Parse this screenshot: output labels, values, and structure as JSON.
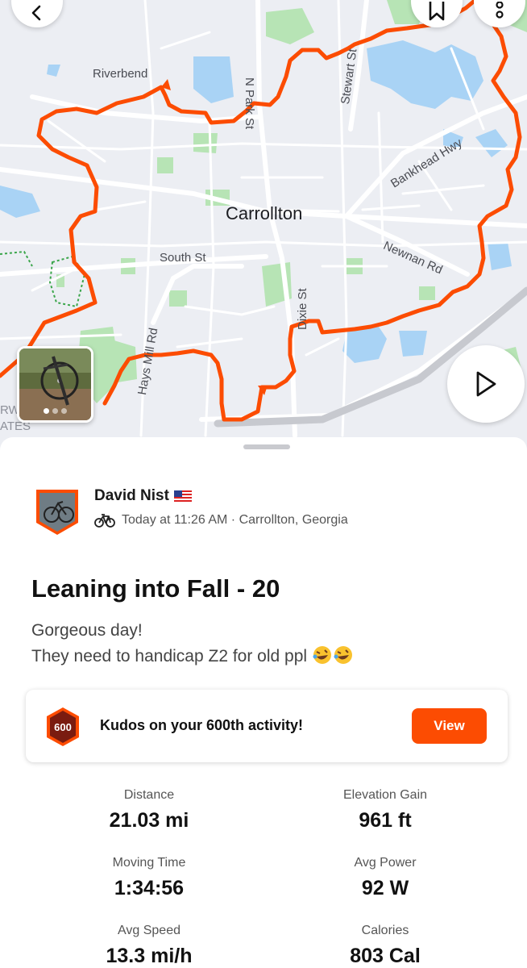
{
  "map": {
    "labels": {
      "city": "Carrollton",
      "riverbend": "Riverbend",
      "n_park_st": "N Park St",
      "stewart_st": "Stewart St",
      "bankhead_hwy": "Bankhead Hwy",
      "newnan_rd": "Newnan Rd",
      "south_st": "South St",
      "dixie_st": "Dixie St",
      "hays_mill_rd": "Hays Mill Rd",
      "edge_rw": "RW",
      "edge_ates": "ATES"
    },
    "route_color": "#fc4c02"
  },
  "athlete": {
    "name": "David Nist",
    "activity_meta": "Today at 11:26 AM · Carrollton, Georgia"
  },
  "activity": {
    "title": "Leaning into Fall - 20",
    "description_line1": "Gorgeous day!",
    "description_line2": "They need to handicap Z2 for old ppl"
  },
  "kudos": {
    "badge_number": "600",
    "message": "Kudos on your 600th activity!",
    "button_label": "View"
  },
  "stats": [
    {
      "label": "Distance",
      "value": "21.03 mi"
    },
    {
      "label": "Elevation Gain",
      "value": "961 ft"
    },
    {
      "label": "Moving Time",
      "value": "1:34:56"
    },
    {
      "label": "Avg Power",
      "value": "92 W"
    },
    {
      "label": "Avg Speed",
      "value": "13.3 mi/h"
    },
    {
      "label": "Calories",
      "value": "803 Cal"
    }
  ],
  "colors": {
    "accent": "#fc4c02",
    "map_background": "#eceef3",
    "water": "#a9d3f5",
    "park": "#b7e4b5"
  }
}
